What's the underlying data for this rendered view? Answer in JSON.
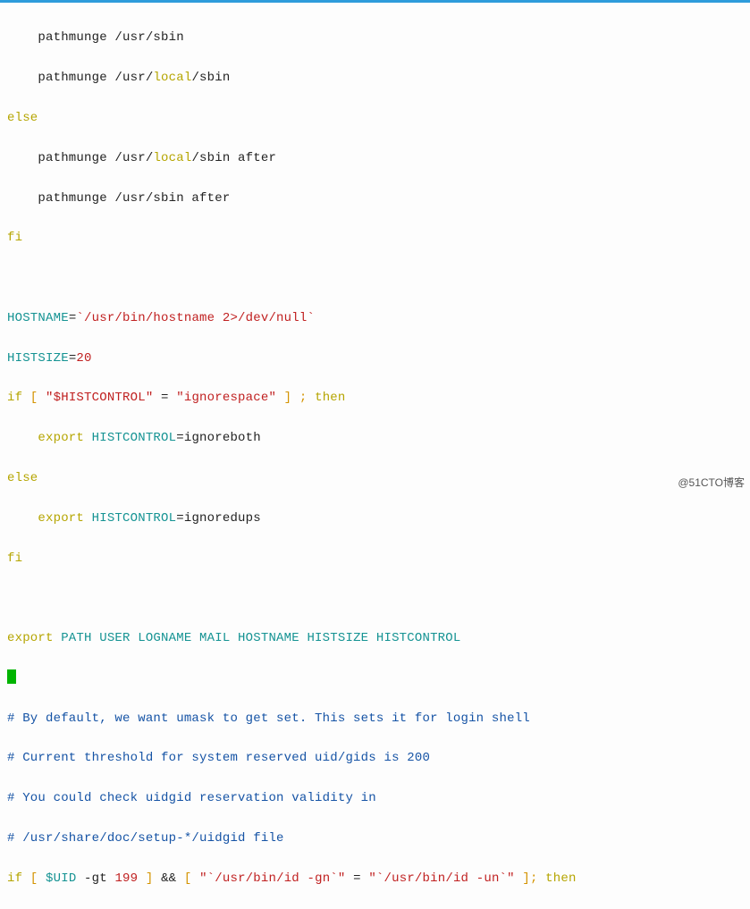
{
  "lines": {
    "l01_a": "    pathmunge /usr/sbin",
    "l02_a": "    pathmunge /usr/",
    "l02_b": "local",
    "l02_c": "/sbin",
    "l03_a": "else",
    "l04_a": "    pathmunge /usr/",
    "l04_b": "local",
    "l04_c": "/sbin after",
    "l05_a": "    pathmunge /usr/sbin after",
    "l06_a": "fi",
    "l07_a": " ",
    "l08_a": "HOSTNAME",
    "l08_b": "=",
    "l08_c": "`/usr/bin/hostname 2>/dev/null`",
    "l09_a": "HISTSIZE",
    "l09_b": "=",
    "l09_c": "20",
    "l10_a": "if",
    "l10_b": " [ ",
    "l10_c": "\"$HISTCONTROL\"",
    "l10_d": " = ",
    "l10_e": "\"ignorespace\"",
    "l10_f": " ] ; ",
    "l10_g": "then",
    "l11_a": "    ",
    "l11_b": "export",
    "l11_c": " HISTCONTROL",
    "l11_d": "=",
    "l11_e": "ignoreboth",
    "l12_a": "else",
    "l13_a": "    ",
    "l13_b": "export",
    "l13_c": " HISTCONTROL",
    "l13_d": "=",
    "l13_e": "ignoredups",
    "l14_a": "fi",
    "l15_a": " ",
    "l16_a": "export",
    "l16_b": " PATH USER LOGNAME MAIL HOSTNAME HISTSIZE HISTCONTROL",
    "l17_a": " ",
    "l18_a": "# By default, we want umask to get set. This sets it for login shell",
    "l19_a": "# Current threshold for system reserved uid/gids is 200",
    "l20_a": "# You could check uidgid reservation validity in",
    "l21_a": "# /usr/share/doc/setup-*/uidgid file",
    "l22_a": "if",
    "l22_b": " [ ",
    "l22_c": "$UID",
    "l22_d": " -gt ",
    "l22_e": "199",
    "l22_f": " ] ",
    "l22_g": "&&",
    "l22_h": " [ ",
    "l22_i": "\"`/usr/bin/id -gn`\"",
    "l22_j": " = ",
    "l22_k": "\"`/usr/bin/id -un`\"",
    "l22_l": " ]; ",
    "l22_m": "then"
  },
  "watermark": "@51CTO博客"
}
